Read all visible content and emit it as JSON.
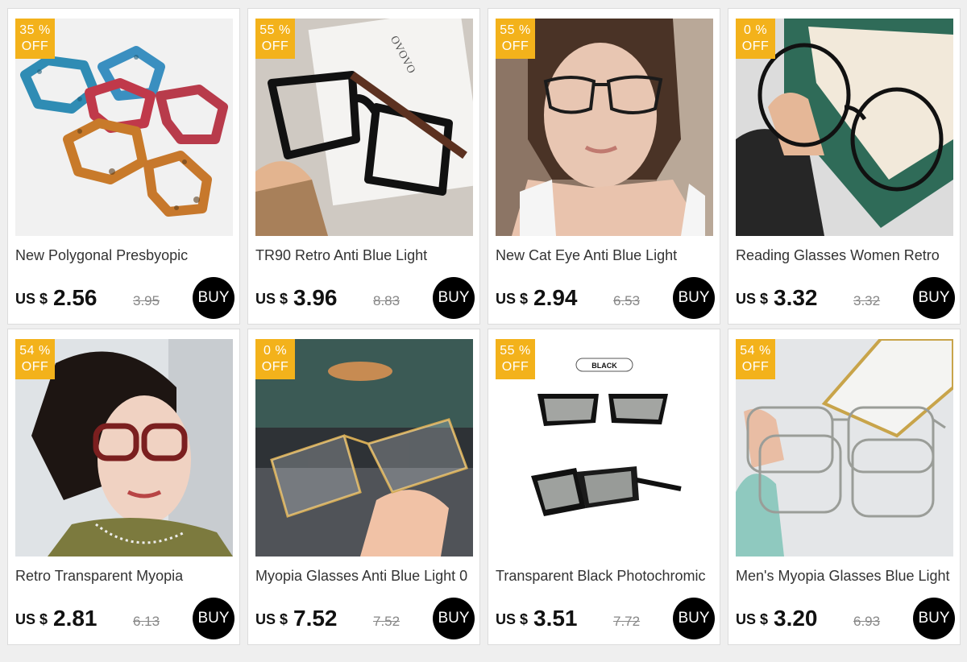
{
  "products": [
    {
      "discount": "35",
      "discount_unit": "%",
      "off_label": "OFF",
      "title": "New Polygonal Presbyopic",
      "currency": "US $",
      "price": "2.56",
      "old_price": "3.95",
      "buy_label": "BUY",
      "image": "tortoiseshell-reading-glasses-photo"
    },
    {
      "discount": "55",
      "discount_unit": "%",
      "off_label": "OFF",
      "title": "TR90 Retro Anti Blue Light",
      "currency": "US $",
      "price": "3.96",
      "old_price": "8.83",
      "buy_label": "BUY",
      "image": "black-square-glasses-in-hand-photo",
      "image_text": "OVOVO"
    },
    {
      "discount": "55",
      "discount_unit": "%",
      "off_label": "OFF",
      "title": "New Cat Eye Anti Blue Light",
      "currency": "US $",
      "price": "2.94",
      "old_price": "6.53",
      "buy_label": "BUY",
      "image": "woman-wearing-cat-eye-glasses-photo"
    },
    {
      "discount": "0",
      "discount_unit": "%",
      "off_label": "OFF",
      "title": "Reading Glasses Women Retro",
      "currency": "US $",
      "price": "3.32",
      "old_price": "3.32",
      "buy_label": "BUY",
      "image": "round-black-glasses-in-hand-photo"
    },
    {
      "discount": "54",
      "discount_unit": "%",
      "off_label": "OFF",
      "title": "Retro Transparent Myopia",
      "currency": "US $",
      "price": "2.81",
      "old_price": "6.13",
      "buy_label": "BUY",
      "image": "woman-wearing-red-frame-glasses-photo"
    },
    {
      "discount": "0",
      "discount_unit": "%",
      "off_label": "OFF",
      "title": "Myopia Glasses Anti Blue Light 0",
      "currency": "US $",
      "price": "7.52",
      "old_price": "7.52",
      "buy_label": "BUY",
      "image": "rimless-gold-glasses-in-hand-photo"
    },
    {
      "discount": "55",
      "discount_unit": "%",
      "off_label": "OFF",
      "title": "Transparent Black Photochromic",
      "currency": "US $",
      "price": "3.51",
      "old_price": "7.72",
      "buy_label": "BUY",
      "image": "black-photochromic-sport-glasses-photo",
      "image_text": "BLACK"
    },
    {
      "discount": "54",
      "discount_unit": "%",
      "off_label": "OFF",
      "title": "Men's Myopia Glasses Blue Light",
      "currency": "US $",
      "price": "3.20",
      "old_price": "6.93",
      "buy_label": "BUY",
      "image": "silver-metal-frame-glasses-photo"
    }
  ],
  "colors": {
    "badge": "#f3b21b",
    "buy_button": "#000000",
    "background": "#efefef"
  }
}
